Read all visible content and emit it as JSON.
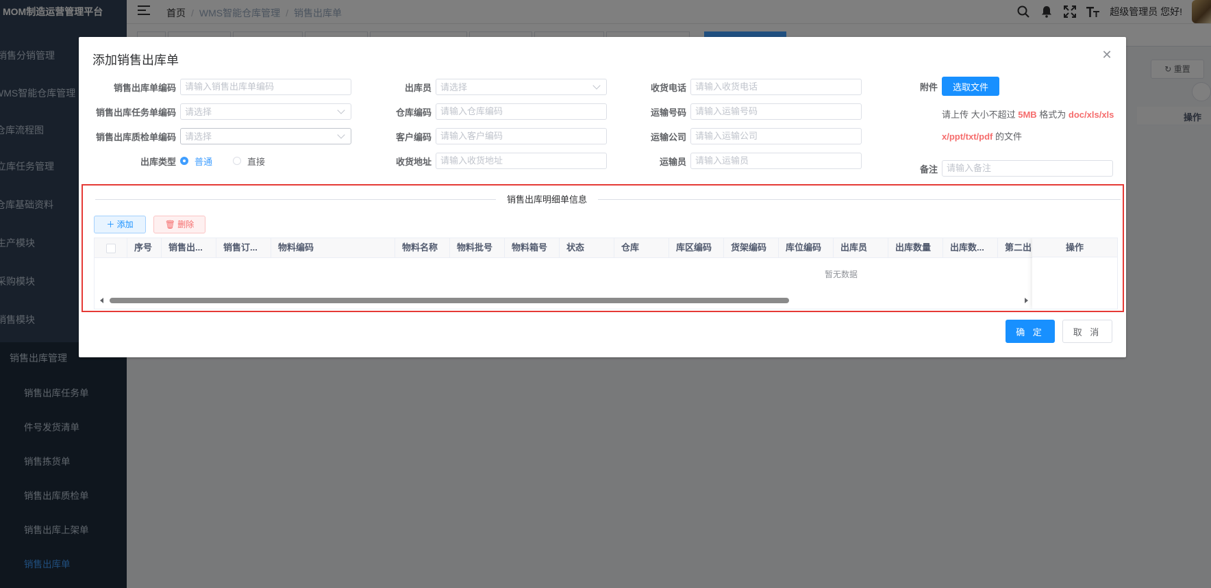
{
  "app": {
    "title": "MOM制造运营管理平台"
  },
  "sidebar": {
    "items": [
      {
        "label": "销售分销管理"
      },
      {
        "label": "WMS智能仓库管理"
      },
      {
        "label": "仓库流程图"
      },
      {
        "label": "立库任务管理"
      },
      {
        "label": "仓库基础资料"
      },
      {
        "label": "生产模块"
      },
      {
        "label": "采购模块"
      },
      {
        "label": "销售模块"
      },
      {
        "label": "销售出库管理"
      },
      {
        "label": "销售出库任务单"
      },
      {
        "label": "件号发货清单"
      },
      {
        "label": "销售拣货单"
      },
      {
        "label": "销售出库质检单"
      },
      {
        "label": "销售出库上架单"
      },
      {
        "label": "销售出库单"
      }
    ]
  },
  "header": {
    "breadcrumb": [
      "首页",
      "WMS智能仓库管理",
      "销售出库单"
    ],
    "user_greeting": "超级管理员 您好!"
  },
  "page_behind": {
    "reset_label": "重置",
    "operation_header": "操作"
  },
  "dialog": {
    "title": "添加销售出库单",
    "fields": {
      "code": {
        "label": "销售出库单编码",
        "placeholder": "请输入销售出库单编码"
      },
      "task_code": {
        "label": "销售出库任务单编码",
        "placeholder": "请选择"
      },
      "qc_code": {
        "label": "销售出库质检单编码",
        "placeholder": "请选择"
      },
      "out_type": {
        "label": "出库类型",
        "options": [
          "普通",
          "直接"
        ],
        "selected": "普通"
      },
      "operator": {
        "label": "出库员",
        "placeholder": "请选择"
      },
      "warehouse_code": {
        "label": "仓库编码",
        "placeholder": "请输入仓库编码"
      },
      "customer_code": {
        "label": "客户编码",
        "placeholder": "请输入客户编码"
      },
      "address": {
        "label": "收货地址",
        "placeholder": "请输入收货地址"
      },
      "phone": {
        "label": "收货电话",
        "placeholder": "请输入收货电话"
      },
      "shipping_no": {
        "label": "运输号码",
        "placeholder": "请输入运输号码"
      },
      "carrier": {
        "label": "运输公司",
        "placeholder": "请输入运输公司"
      },
      "transporter": {
        "label": "运输员",
        "placeholder": "请输入运输员"
      },
      "attachment": {
        "label": "附件",
        "button": "选取文件"
      },
      "remark": {
        "label": "备注",
        "placeholder": "请输入备注"
      }
    },
    "upload_tip": {
      "prefix": "请上传 大小不超过 ",
      "size": "5MB",
      "middle": " 格式为 ",
      "formats": "doc/xls/xlsx/ppt/txt/pdf",
      "suffix": " 的文件"
    },
    "detail": {
      "title": "销售出库明细单信息",
      "add_label": "添加",
      "delete_label": "删除",
      "columns": [
        "序号",
        "销售出...",
        "销售订...",
        "物料编码",
        "物料名称",
        "物料批号",
        "物料箱号",
        "状态",
        "仓库",
        "库区编码",
        "货架编码",
        "库位编码",
        "出库员",
        "出库数量",
        "出库数...",
        "第二出"
      ],
      "operation_header": "操作",
      "empty_text": "暂无数据"
    },
    "footer": {
      "ok_label": "确 定",
      "cancel_label": "取 消"
    }
  }
}
